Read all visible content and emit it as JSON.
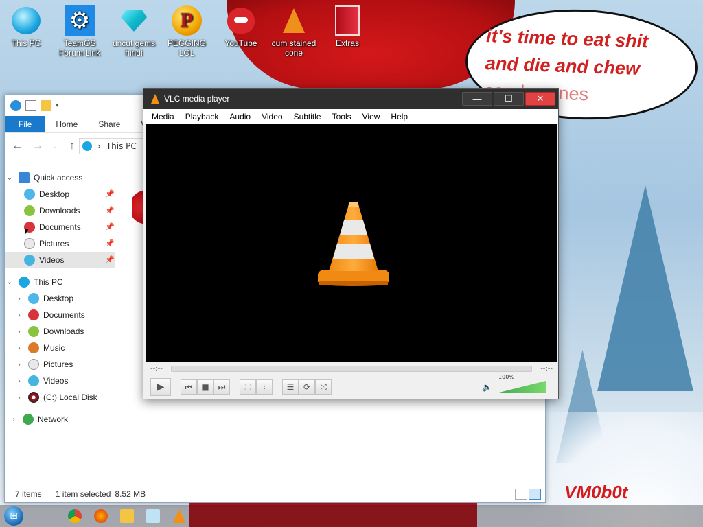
{
  "desktop": {
    "icons": [
      {
        "label": "This PC"
      },
      {
        "label": "TeamOS Forum Link"
      },
      {
        "label": "uncut gems hindi"
      },
      {
        "label": "PEGGING LOL"
      },
      {
        "label": "YouTube"
      },
      {
        "label": "cum stained cone"
      },
      {
        "label": "Extras"
      }
    ],
    "speech_lines": [
      "it's time to eat shit",
      "and die and chew"
    ],
    "speech_faded": "candy canes",
    "watermark": "VM0b0t",
    "peg_letter": "P"
  },
  "explorer": {
    "ribbon_tabs": [
      "File",
      "Home",
      "Share",
      "View"
    ],
    "address": "This PC",
    "address_sep": "›",
    "nav": {
      "quick_access": {
        "label": "Quick access",
        "items": [
          "Desktop",
          "Downloads",
          "Documents",
          "Pictures",
          "Videos"
        ]
      },
      "this_pc": {
        "label": "This PC",
        "items": [
          "Desktop",
          "Documents",
          "Downloads",
          "Music",
          "Pictures",
          "Videos",
          "(C:) Local Disk"
        ]
      },
      "network": "Network"
    },
    "status": {
      "items": "7 items",
      "selection": "1 item selected",
      "size": "8.52 MB"
    }
  },
  "vlc": {
    "title": "VLC media player",
    "menu": [
      "Media",
      "Playback",
      "Audio",
      "Video",
      "Subtitle",
      "Tools",
      "View",
      "Help"
    ],
    "time_left": "--:--",
    "time_right": "--:--",
    "volume_pct": "100%",
    "volume_level": 1.0
  },
  "colors": {
    "accent": "#1979ca",
    "vlc_orange": "#f29111",
    "speech_red": "#d02020"
  }
}
